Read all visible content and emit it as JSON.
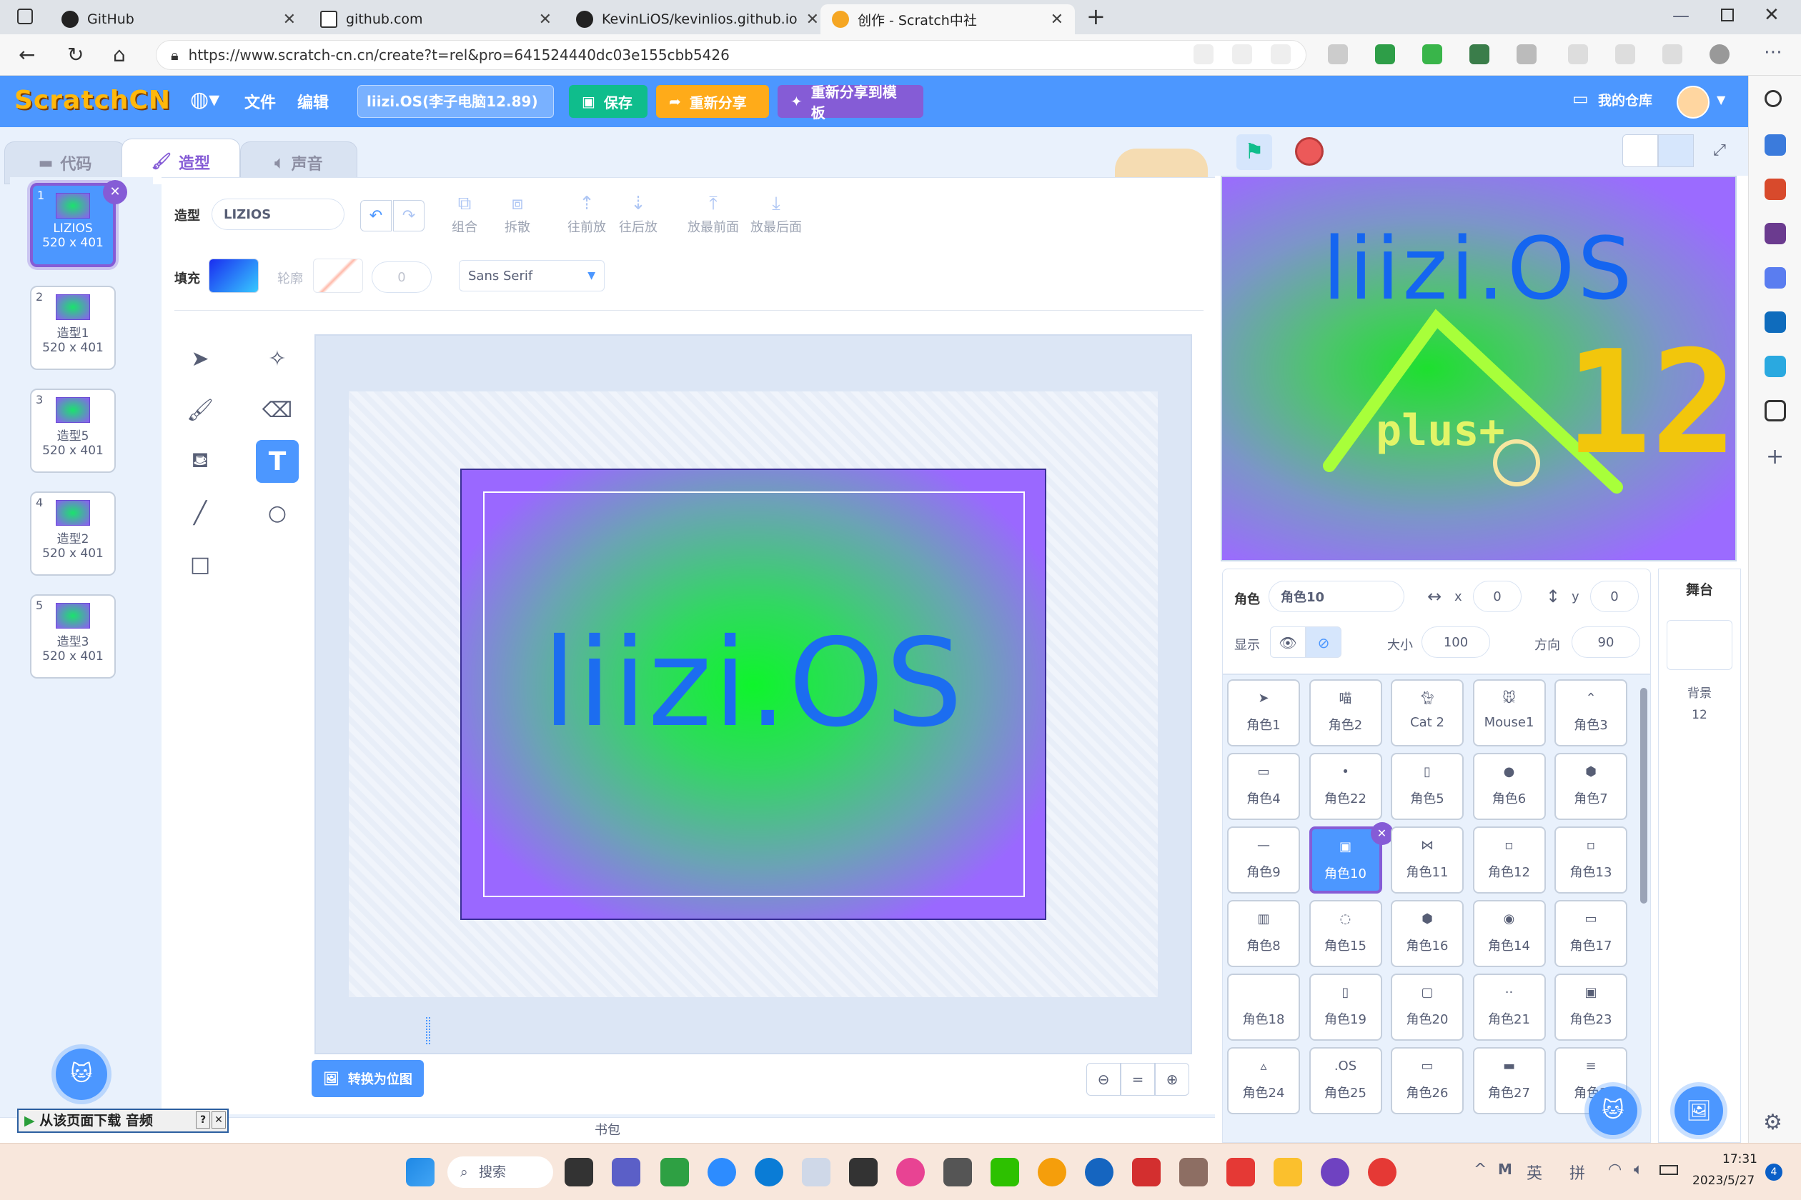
{
  "browser": {
    "tabs": [
      {
        "title": "GitHub"
      },
      {
        "title": "github.com"
      },
      {
        "title": "KevinLiOS/kevinlios.github.io"
      },
      {
        "title": "创作 - Scratch中社"
      }
    ],
    "url": "https://www.scratch-cn.cn/create?t=rel&pro=641524440dc03e155cbb5426"
  },
  "menu": {
    "logo": "ScratchCN",
    "file": "文件",
    "edit": "编辑",
    "project_title": "liizi.OS(李子电脑12.89)",
    "save": "保存",
    "reshare": "重新分享",
    "reshare_template": "重新分享到模板",
    "my_stuff": "我的仓库"
  },
  "editor_tabs": {
    "code": "代码",
    "costumes": "造型",
    "sounds": "声音"
  },
  "costumes": [
    {
      "num": "1",
      "name": "LIZIOS",
      "size": "520 x 401"
    },
    {
      "num": "2",
      "name": "造型1",
      "size": "520 x 401"
    },
    {
      "num": "3",
      "name": "造型5",
      "size": "520 x 401"
    },
    {
      "num": "4",
      "name": "造型2",
      "size": "520 x 401"
    },
    {
      "num": "5",
      "name": "造型3",
      "size": "520 x 401"
    }
  ],
  "paint": {
    "costume_label": "造型",
    "costume_name": "LIZIOS",
    "group": "组合",
    "ungroup": "拆散",
    "forward": "往前放",
    "backward": "往后放",
    "front": "放最前面",
    "back": "放最后面",
    "fill_label": "填充",
    "outline_label": "轮廓",
    "outline_size": "0",
    "font": "Sans Serif",
    "convert": "转换为位图",
    "canvas_text": "liizi.OS"
  },
  "stage": {
    "title": "liizi.OS",
    "plus": "plus+",
    "version": "12"
  },
  "sprite_info": {
    "sprite_label": "角色",
    "sprite_name": "角色10",
    "x_label": "x",
    "x": "0",
    "y_label": "y",
    "y": "0",
    "show_label": "显示",
    "size_label": "大小",
    "size": "100",
    "direction_label": "方向",
    "direction": "90"
  },
  "sprites": [
    "角色1",
    "角色2",
    "Cat 2",
    "Mouse1",
    "角色3",
    "角色4",
    "角色22",
    "角色5",
    "角色6",
    "角色7",
    "角色9",
    "角色10",
    "角色11",
    "角色12",
    "角色13",
    "角色8",
    "角色15",
    "角色16",
    "角色14",
    "角色17",
    "角色18",
    "角色19",
    "角色20",
    "角色21",
    "角色23",
    "角色24",
    "角色25",
    "角色26",
    "角色27",
    "角色2"
  ],
  "stage_panel": {
    "title": "舞台",
    "backdrop_label": "背景",
    "backdrop_count": "12"
  },
  "backpack": "书包",
  "download_bar": "从该页面下载 音频",
  "taskbar": {
    "search": "搜索",
    "lang1": "英",
    "lang2": "拼",
    "time": "17:31",
    "date": "2023/5/27",
    "notif": "4"
  }
}
